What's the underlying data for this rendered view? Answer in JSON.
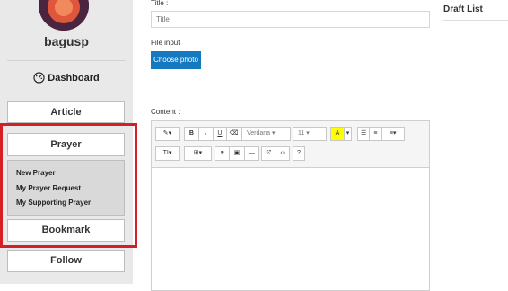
{
  "sidebar": {
    "username": "bagusp",
    "dashboard_label": "Dashboard",
    "nav": {
      "article": "Article",
      "prayer": "Prayer",
      "bookmark": "Bookmark",
      "follow": "Follow"
    },
    "prayer_submenu": [
      "New Prayer",
      "My Prayer Request",
      "My Supporting Prayer"
    ]
  },
  "form": {
    "title_label": "Title :",
    "title_placeholder": "Title",
    "file_label": "File input",
    "choose_photo": "Choose photo",
    "content_label": "Content :",
    "toolbar": {
      "font_family": "Verdana",
      "font_size": "11",
      "bold": "B",
      "italic": "I",
      "underline": "U",
      "help": "?"
    }
  },
  "draft": {
    "title": "Draft List"
  },
  "colors": {
    "accent": "#1579c2",
    "highlight_border": "#d51f26",
    "sidebar_bg": "#e9e9e9"
  }
}
